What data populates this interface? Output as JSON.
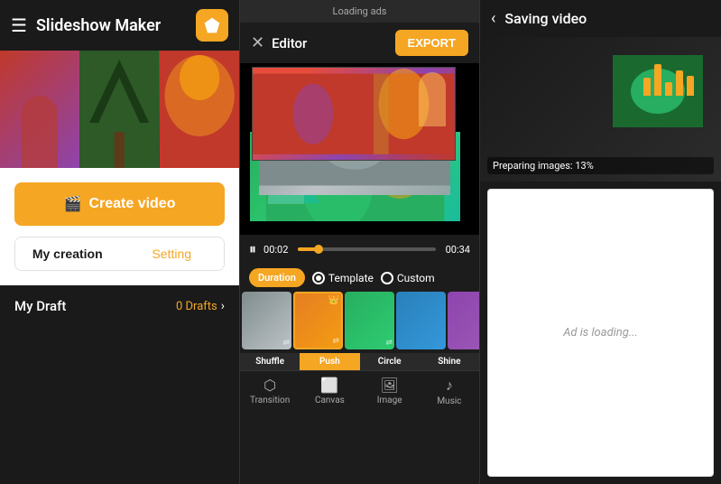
{
  "app": {
    "title": "Slideshow Maker"
  },
  "left": {
    "header_title": "Slideshow Maker",
    "create_btn": "Create video",
    "tab_my_creation": "My creation",
    "tab_setting": "Setting",
    "draft_label": "My Draft",
    "draft_count": "0 Drafts"
  },
  "middle": {
    "ads_label": "Loading ads",
    "editor_title": "Editor",
    "export_btn": "EXPORT",
    "time_current": "00:02",
    "time_total": "00:34",
    "duration_badge": "Duration",
    "template_label": "Template",
    "custom_label": "Custom",
    "trans_tabs": [
      {
        "label": "Shuffle",
        "active": false
      },
      {
        "label": "Push",
        "active": true
      },
      {
        "label": "Circle",
        "active": false
      },
      {
        "label": "Shine",
        "active": false
      }
    ],
    "bottom_nav": [
      {
        "label": "Transition",
        "icon": "⬡"
      },
      {
        "label": "Canvas",
        "icon": "⬜"
      },
      {
        "label": "Image",
        "icon": "🖼"
      },
      {
        "label": "Music",
        "icon": "♪"
      }
    ]
  },
  "right": {
    "back_label": "‹",
    "saving_title": "Saving video",
    "preparing_text": "Preparing images: 13%",
    "ad_loading_text": "Ad is loading..."
  },
  "icons": {
    "hamburger": "☰",
    "close": "✕",
    "play_pause": "⏸",
    "back_arrow": "‹",
    "chevron_right": "›",
    "film_icon": "🎬",
    "crown": "👑"
  }
}
